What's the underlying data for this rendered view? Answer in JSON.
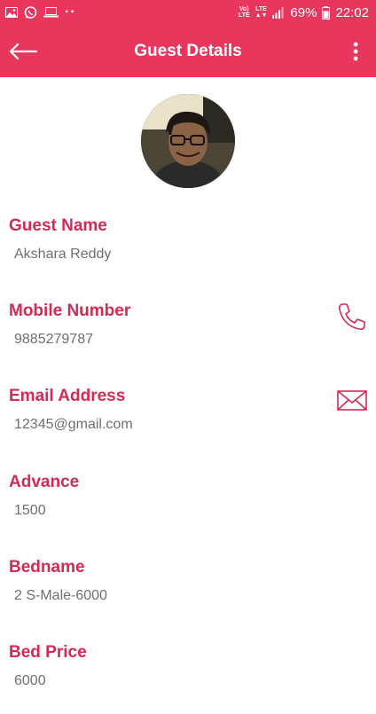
{
  "status_bar": {
    "battery": "69%",
    "time": "22:02",
    "network": "LTE",
    "notification_dots": "··"
  },
  "appbar": {
    "title": "Guest Details"
  },
  "profile": {
    "avatar_icon": "guest-avatar"
  },
  "fields": [
    {
      "label": "Guest Name",
      "value": "Akshara Reddy"
    },
    {
      "label": "Mobile Number",
      "value": "9885279787",
      "action_icon": "phone-icon"
    },
    {
      "label": "Email Address",
      "value": "12345@gmail.com",
      "action_icon": "mail-icon"
    },
    {
      "label": "Advance",
      "value": "1500"
    },
    {
      "label": "Bedname",
      "value": "2 S-Male-6000"
    },
    {
      "label": "Bed Price",
      "value": "6000"
    }
  ],
  "colors": {
    "accent": "#e8365d",
    "label": "#d42a56",
    "value": "#6f6f6f"
  }
}
